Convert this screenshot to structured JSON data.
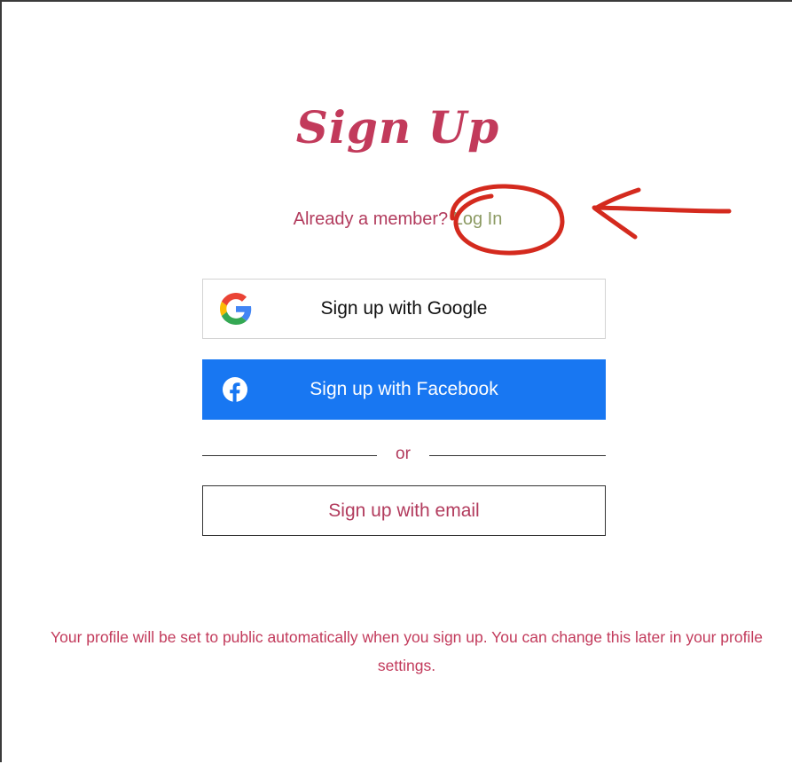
{
  "page": {
    "title": "Sign Up",
    "member_prompt": "Already a member?",
    "login_link": "Log In",
    "google_button": "Sign up with Google",
    "facebook_button": "Sign up with Facebook",
    "divider_text": "or",
    "email_button": "Sign up with email",
    "notice": "Your profile will be set to public automatically when you sign up. You can change this later in your profile settings."
  },
  "icons": {
    "google": "google-icon",
    "facebook": "facebook-icon"
  },
  "colors": {
    "accent": "#c23a5b",
    "link": "#8c9a63",
    "facebook_blue": "#1877f2",
    "annotation_red": "#d42a1e"
  },
  "annotation": {
    "circle_target": "login-link",
    "arrow_points_to": "login-link"
  }
}
